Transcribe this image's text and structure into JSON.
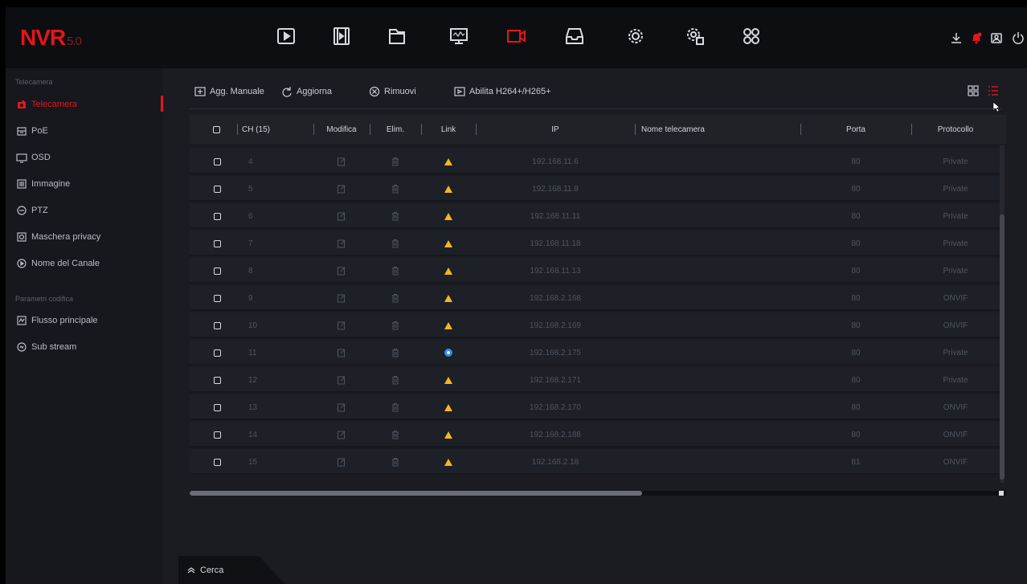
{
  "app": {
    "logo": "NVR",
    "version": "5.0"
  },
  "top_nav": [
    {
      "name": "playback-icon",
      "active": false
    },
    {
      "name": "film-icon",
      "active": false
    },
    {
      "name": "file-icon",
      "active": false
    },
    {
      "name": "monitor-icon",
      "active": false
    },
    {
      "name": "camera-icon",
      "active": true
    },
    {
      "name": "storage-icon",
      "active": false
    },
    {
      "name": "gear-icon",
      "active": false
    },
    {
      "name": "system-settings-icon",
      "active": false
    },
    {
      "name": "apps-grid-icon",
      "active": false
    }
  ],
  "sidebar": {
    "section1": "Telecamera",
    "items": [
      {
        "label": "Telecamera",
        "icon": "camera-icon",
        "active": true
      },
      {
        "label": "PoE",
        "icon": "poe-icon"
      },
      {
        "label": "OSD",
        "icon": "osd-icon"
      },
      {
        "label": "Immagine",
        "icon": "image-icon"
      },
      {
        "label": "PTZ",
        "icon": "ptz-icon"
      },
      {
        "label": "Maschera privacy",
        "icon": "privacy-mask-icon"
      },
      {
        "label": "Nome del Canale",
        "icon": "channel-name-icon"
      }
    ],
    "section2": "Parametri codifica",
    "items2": [
      {
        "label": "Flusso principale",
        "icon": "main-stream-icon"
      },
      {
        "label": "Sub stream",
        "icon": "sub-stream-icon"
      }
    ]
  },
  "toolbar": {
    "add_manual": "Agg. Manuale",
    "refresh": "Aggiorna",
    "remove": "Rimuovi",
    "enable_codec": "Abilita H264+/H265+"
  },
  "table": {
    "headers": {
      "ch": "CH (15)",
      "edit": "Modifica",
      "delete": "Elim.",
      "link": "Link",
      "ip": "IP",
      "name": "Nome telecamera",
      "port": "Porta",
      "protocol": "Protocollo"
    },
    "rows": [
      {
        "ch": "4",
        "link": "warning",
        "ip": "192.168.11.6",
        "name": "",
        "port": "80",
        "protocol": "Private"
      },
      {
        "ch": "5",
        "link": "warning",
        "ip": "192.168.11.8",
        "name": "",
        "port": "80",
        "protocol": "Private"
      },
      {
        "ch": "6",
        "link": "warning",
        "ip": "192.168.11.11",
        "name": "",
        "port": "80",
        "protocol": "Private"
      },
      {
        "ch": "7",
        "link": "warning",
        "ip": "192.168.11.18",
        "name": "",
        "port": "80",
        "protocol": "Private"
      },
      {
        "ch": "8",
        "link": "warning",
        "ip": "192.168.11.13",
        "name": "",
        "port": "80",
        "protocol": "Private"
      },
      {
        "ch": "9",
        "link": "warning",
        "ip": "192.168.2.168",
        "name": "",
        "port": "80",
        "protocol": "ONVIF"
      },
      {
        "ch": "10",
        "link": "warning",
        "ip": "192.168.2.169",
        "name": "",
        "port": "80",
        "protocol": "ONVIF"
      },
      {
        "ch": "11",
        "link": "connected",
        "ip": "192.168.2.175",
        "name": "",
        "port": "80",
        "protocol": "Private"
      },
      {
        "ch": "12",
        "link": "warning",
        "ip": "192.168.2.171",
        "name": "",
        "port": "80",
        "protocol": "Private"
      },
      {
        "ch": "13",
        "link": "warning",
        "ip": "192.168.2.170",
        "name": "",
        "port": "80",
        "protocol": "ONVIF"
      },
      {
        "ch": "14",
        "link": "warning",
        "ip": "192.168.2.188",
        "name": "",
        "port": "80",
        "protocol": "ONVIF"
      },
      {
        "ch": "15",
        "link": "warning",
        "ip": "192.168.2.18",
        "name": "",
        "port": "81",
        "protocol": "ONVIF"
      }
    ]
  },
  "search_tab": {
    "label": "Cerca"
  },
  "colors": {
    "accent": "#e3161b",
    "warning": "#f5b71e",
    "connected": "#2f8df3"
  }
}
